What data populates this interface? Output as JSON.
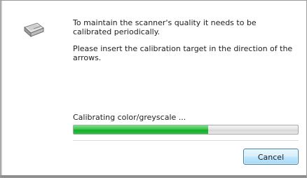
{
  "dialog": {
    "icon": "scanner-icon",
    "message_line_1": "To maintain the scanner's quality it needs to be calibrated periodically.",
    "message_line_2": "Please insert the calibration target in the direction of the arrows.",
    "progress_label": "Calibrating color/greyscale ...",
    "progress_fraction": 0.6,
    "cancel_label": "Cancel"
  },
  "colors": {
    "progress_fill": "#26b83a",
    "button_border": "#3c7fb1"
  }
}
